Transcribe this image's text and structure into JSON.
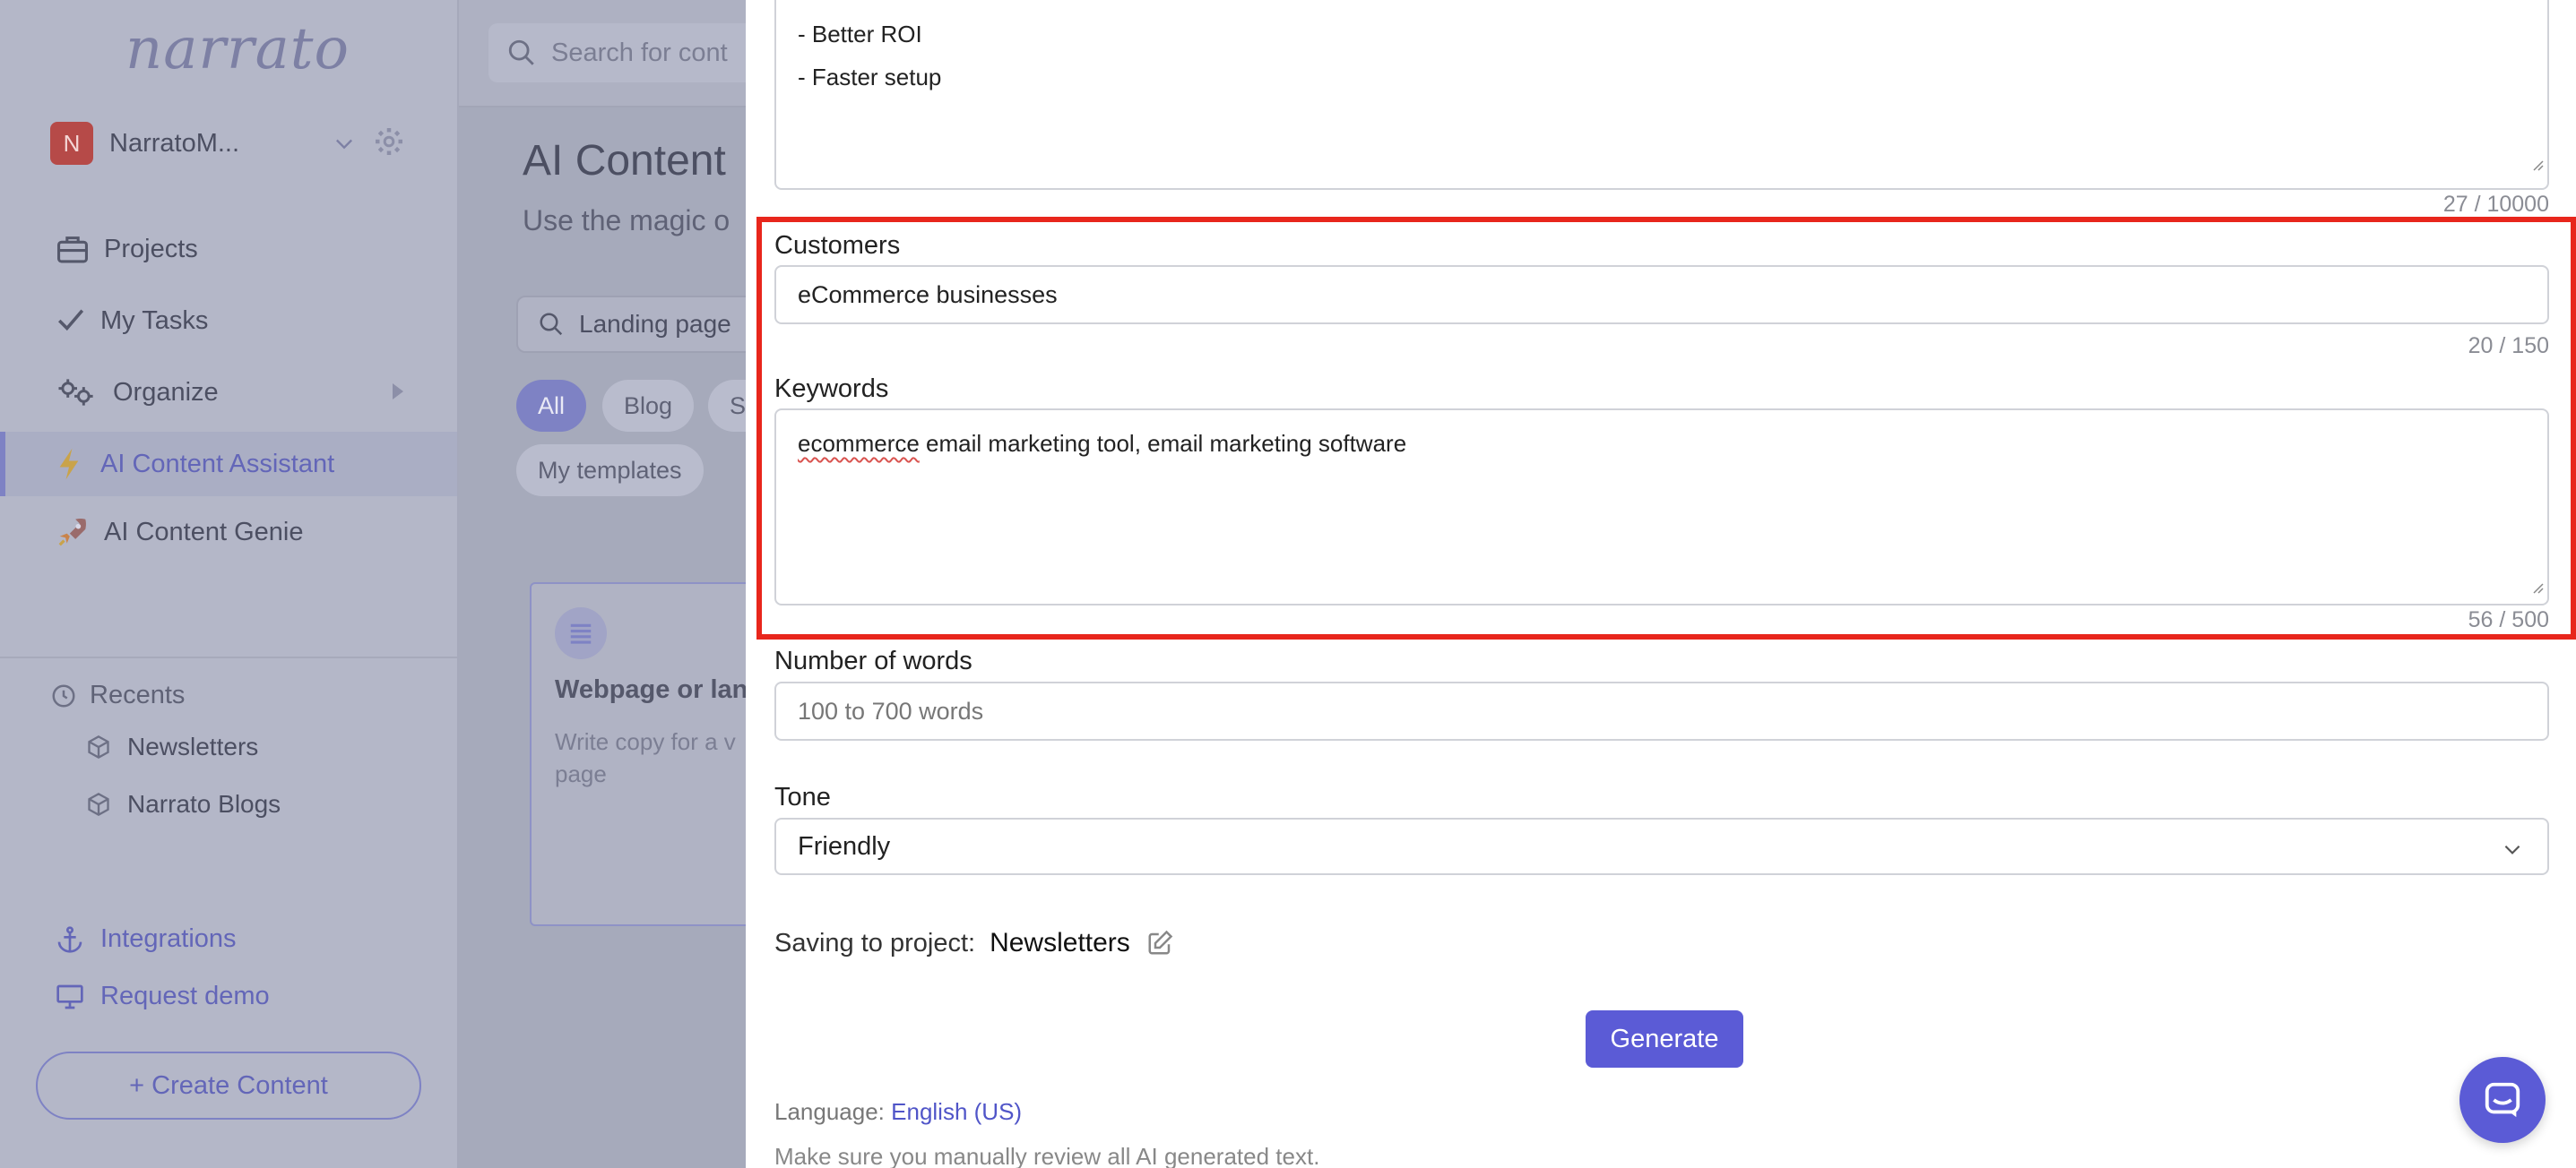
{
  "sidebar": {
    "logo": "narrato",
    "workspace": {
      "initial": "N",
      "name": "NarratoM..."
    },
    "nav": {
      "projects": "Projects",
      "my_tasks": "My Tasks",
      "organize": "Organize",
      "ai_content_assistant": "AI Content Assistant",
      "ai_content_genie": "AI Content Genie"
    },
    "recents": {
      "title": "Recents",
      "items": [
        "Newsletters",
        "Narrato Blogs"
      ]
    },
    "integrations": "Integrations",
    "request_demo": "Request demo",
    "create_content": "+ Create Content"
  },
  "background": {
    "search_placeholder": "Search for cont",
    "title": "AI Content",
    "subtitle": "Use the magic o",
    "filter_value": "Landing page",
    "chips": {
      "all": "All",
      "blog": "Blog",
      "s": "S",
      "my_templates": "My templates"
    },
    "card": {
      "title": "Webpage or lan",
      "desc": "Write copy for a v page"
    }
  },
  "panel": {
    "top_textarea": {
      "lines": [
        "- Better ROI",
        "- Faster setup"
      ],
      "counter": "27 / 10000"
    },
    "customers": {
      "label": "Customers",
      "value": "eCommerce businesses",
      "counter": "20 / 150"
    },
    "keywords": {
      "label": "Keywords",
      "misspelled": "ecommerce",
      "rest": " email marketing tool, email marketing software",
      "counter": "56 / 500"
    },
    "words": {
      "label": "Number of words",
      "placeholder": "100 to 700 words"
    },
    "tone": {
      "label": "Tone",
      "value": "Friendly"
    },
    "saving": {
      "label": "Saving to project:",
      "project": "Newsletters"
    },
    "generate": "Generate",
    "language": {
      "label": "Language:",
      "value": "English (US)"
    },
    "disclaimer": "Make sure you manually review all AI generated text."
  },
  "colors": {
    "accent": "#5b5bd6",
    "highlight": "#e8261c",
    "sidebar_bg": "#b4b7c8"
  }
}
